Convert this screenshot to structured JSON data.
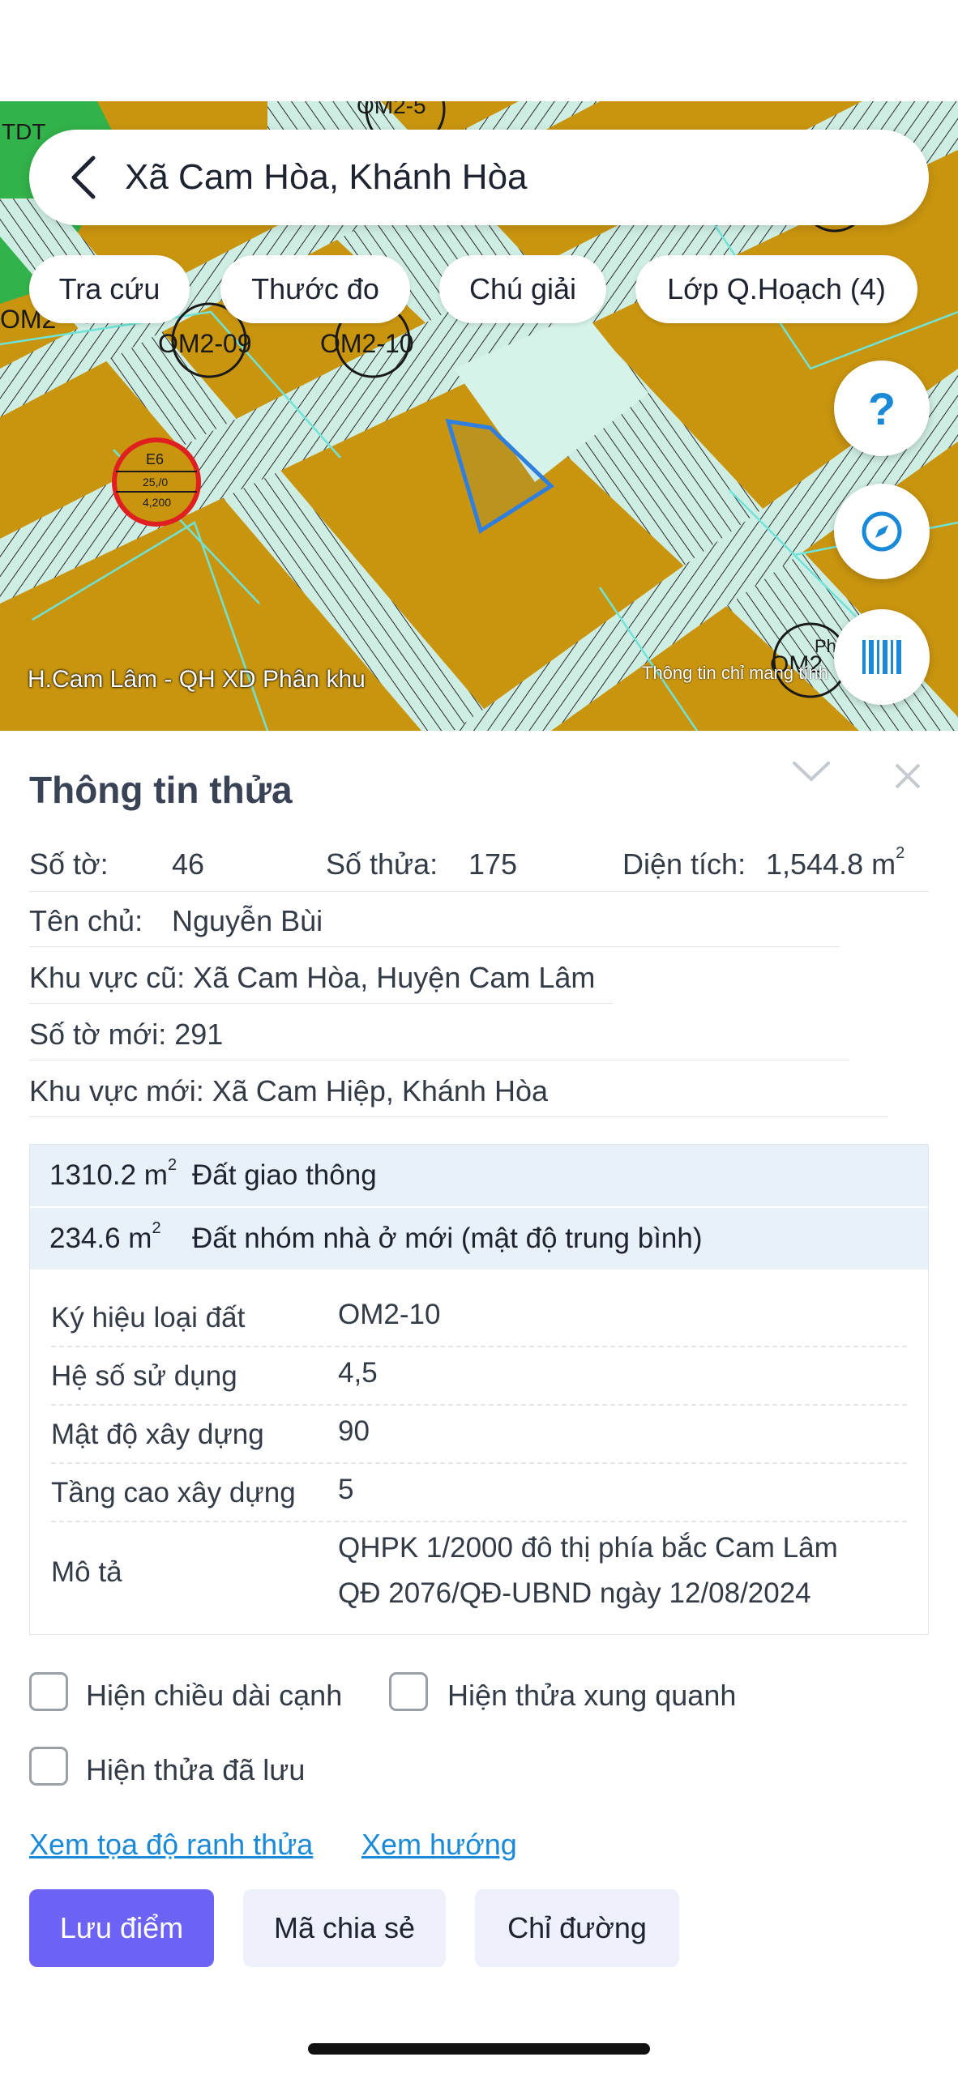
{
  "header": {
    "title": "Xã Cam Hòa, Khánh Hòa"
  },
  "chips": [
    "Tra cứu",
    "Thước đo",
    "Chú giải",
    "Lớp Q.Hoạch (4)"
  ],
  "map": {
    "source_label": "H.Cam Lâm - QH XD Phân khu",
    "notice": "Thông tin chỉ mang tính",
    "zone_labels": [
      "OM2-09",
      "OM2-10",
      "TDT",
      "OM2-",
      "E6",
      "25,/0",
      "4,200",
      "OM2-5",
      "Ph",
      "OM2"
    ],
    "fab_help": "?",
    "colors": {
      "land": "#c9950f",
      "road": "#cfeee3",
      "boundary": "#2f7fe0",
      "green": "#32b24a",
      "ring": "#e02020"
    }
  },
  "panel": {
    "title": "Thông tin thửa",
    "so_to_label": "Số tờ:",
    "so_to_value": "46",
    "so_thua_label": "Số thửa:",
    "so_thua_value": "175",
    "dien_tich_label": "Diện tích:",
    "dien_tich_value": "1,544.8 m",
    "ten_chu_label": "Tên chủ:",
    "ten_chu_value": "Nguyễn Bùi",
    "khu_vuc_cu": "Khu vực cũ: Xã Cam Hòa, Huyện Cam Lâm",
    "so_to_moi": "Số tờ mới: 291",
    "khu_vuc_moi": "Khu vực mới: Xã Cam Hiệp, Khánh Hòa"
  },
  "zones": [
    {
      "area": "1310.2 m",
      "name": "Đất giao thông"
    },
    {
      "area": "234.6 m",
      "name": "Đất nhóm nhà ở mới (mật độ trung bình)"
    }
  ],
  "details": {
    "ky_hieu_label": "Ký hiệu loại đất",
    "ky_hieu_value": "OM2-10",
    "he_so_label": "Hệ số sử dụng",
    "he_so_value": "4,5",
    "mat_do_label": "Mật độ xây dựng",
    "mat_do_value": "90",
    "tang_cao_label": "Tầng cao xây dựng",
    "tang_cao_value": "5",
    "mo_ta_label": "Mô tả",
    "mo_ta_line1": "QHPK 1/2000 đô thị phía bắc Cam Lâm",
    "mo_ta_line2": "QĐ 2076/QĐ-UBND ngày 12/08/2024"
  },
  "options": {
    "show_edges": "Hiện chiều dài cạnh",
    "show_neighbors": "Hiện thửa xung quanh",
    "show_saved": "Hiện thửa đã lưu"
  },
  "links": {
    "coords": "Xem tọa độ ranh thửa",
    "direction": "Xem hướng"
  },
  "buttons": {
    "save": "Lưu điểm",
    "share": "Mã chia sẻ",
    "route": "Chỉ đường"
  }
}
